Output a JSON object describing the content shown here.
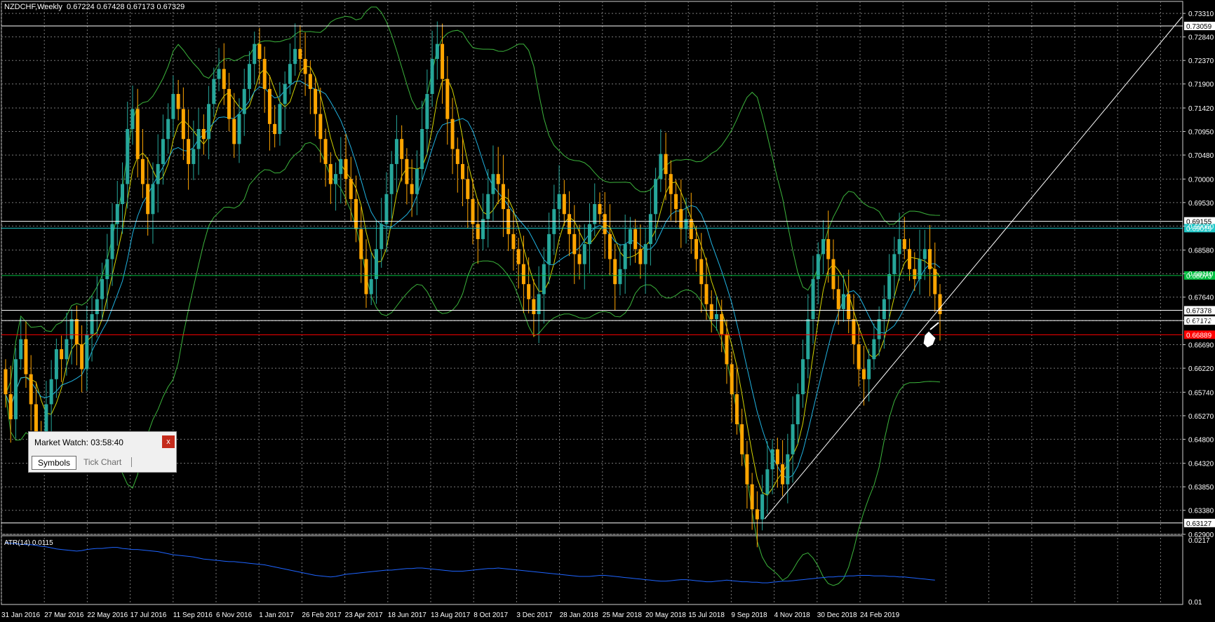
{
  "window": {
    "symbol_header": "NZDCHF,Weekly  0.67224 0.67428 0.67173 0.67329"
  },
  "colors": {
    "background": "#000000",
    "grid": "#7a7a7a",
    "bull_candle": "#26a69a",
    "bear_candle": "#ffa500",
    "bollinger": "#3cb43c",
    "ma_fast": "#d4d400",
    "ma_slow": "#20b2e0",
    "atr_line": "#1e64ff",
    "level_red": "#ff0000",
    "level_green": "#00c040",
    "level_cyan": "#20c8c8"
  },
  "price_axis": {
    "ticks": [
      "0.73310",
      "0.72840",
      "0.72370",
      "0.71900",
      "0.71420",
      "0.70950",
      "0.70480",
      "0.70000",
      "0.69530",
      "0.69060",
      "0.68580",
      "0.68110",
      "0.67640",
      "0.67170",
      "0.66690",
      "0.66220",
      "0.65740",
      "0.65270",
      "0.64800",
      "0.64320",
      "0.63850",
      "0.63380",
      "0.62900"
    ]
  },
  "price_levels": [
    {
      "price": 0.73059,
      "label": "0.73059",
      "style": "white"
    },
    {
      "price": 0.69155,
      "label": "0.69155",
      "style": "white"
    },
    {
      "price": 0.69019,
      "label": "0.69019",
      "style": "cyan"
    },
    {
      "price": 0.68073,
      "label": "0.68073",
      "style": "green"
    },
    {
      "price": 0.67378,
      "label": "0.67378",
      "style": "white"
    },
    {
      "price": 0.67172,
      "label": "0.67172",
      "style": "white"
    },
    {
      "price": 0.66889,
      "label": "0.66889",
      "style": "red"
    },
    {
      "price": 0.63127,
      "label": "0.63127",
      "style": "white"
    }
  ],
  "time_axis": {
    "labels": [
      "31 Jan 2016",
      "27 Mar 2016",
      "22 May 2016",
      "17 Jul 2016",
      "11 Sep 2016",
      "6 Nov 2016",
      "1 Jan 2017",
      "26 Feb 2017",
      "23 Apr 2017",
      "18 Jun 2017",
      "13 Aug 2017",
      "8 Oct 2017",
      "3 Dec 2017",
      "28 Jan 2018",
      "25 Mar 2018",
      "20 May 2018",
      "15 Jul 2018",
      "9 Sep 2018",
      "4 Nov 2018",
      "30 Dec 2018",
      "24 Feb 2019"
    ]
  },
  "atr_panel": {
    "label": "ATR(14) 0.0115",
    "ticks": [
      "0.0217",
      "0.01"
    ]
  },
  "market_watch": {
    "title": "Market Watch: 03:58:40",
    "close_label": "x",
    "tabs": [
      "Symbols",
      "Tick Chart"
    ]
  },
  "chart_data": {
    "type": "candlestick",
    "ylim": [
      0.629,
      0.7355
    ],
    "closes": [
      0.657,
      0.652,
      0.664,
      0.668,
      0.661,
      0.655,
      0.649,
      0.646,
      0.655,
      0.66,
      0.666,
      0.664,
      0.668,
      0.672,
      0.667,
      0.662,
      0.669,
      0.673,
      0.676,
      0.68,
      0.684,
      0.691,
      0.695,
      0.699,
      0.71,
      0.714,
      0.704,
      0.699,
      0.693,
      0.699,
      0.703,
      0.708,
      0.712,
      0.717,
      0.714,
      0.708,
      0.703,
      0.706,
      0.71,
      0.708,
      0.715,
      0.72,
      0.722,
      0.718,
      0.712,
      0.707,
      0.713,
      0.718,
      0.723,
      0.727,
      0.724,
      0.718,
      0.711,
      0.709,
      0.715,
      0.719,
      0.723,
      0.726,
      0.724,
      0.721,
      0.718,
      0.713,
      0.708,
      0.703,
      0.699,
      0.701,
      0.704,
      0.7,
      0.696,
      0.69,
      0.684,
      0.677,
      0.68,
      0.686,
      0.691,
      0.697,
      0.703,
      0.708,
      0.704,
      0.699,
      0.697,
      0.702,
      0.71,
      0.717,
      0.724,
      0.727,
      0.72,
      0.712,
      0.706,
      0.703,
      0.7,
      0.696,
      0.691,
      0.688,
      0.692,
      0.697,
      0.701,
      0.699,
      0.694,
      0.689,
      0.686,
      0.683,
      0.679,
      0.676,
      0.673,
      0.677,
      0.683,
      0.689,
      0.694,
      0.697,
      0.693,
      0.689,
      0.685,
      0.683,
      0.687,
      0.691,
      0.695,
      0.693,
      0.689,
      0.684,
      0.679,
      0.682,
      0.687,
      0.69,
      0.686,
      0.683,
      0.687,
      0.693,
      0.7,
      0.705,
      0.701,
      0.697,
      0.694,
      0.69,
      0.692,
      0.688,
      0.684,
      0.679,
      0.675,
      0.672,
      0.673,
      0.669,
      0.663,
      0.657,
      0.651,
      0.645,
      0.639,
      0.634,
      0.632,
      0.637,
      0.642,
      0.646,
      0.643,
      0.639,
      0.645,
      0.651,
      0.657,
      0.664,
      0.672,
      0.68,
      0.685,
      0.688,
      0.684,
      0.678,
      0.674,
      0.677,
      0.672,
      0.667,
      0.662,
      0.66,
      0.664,
      0.668,
      0.672,
      0.676,
      0.681,
      0.685,
      0.688,
      0.686,
      0.682,
      0.68,
      0.684,
      0.686,
      0.682,
      0.677,
      0.673
    ]
  },
  "atr_data": {
    "ylim": [
      0.0095,
      0.0225
    ],
    "values": [
      0.0212,
      0.0211,
      0.021,
      0.0209,
      0.0208,
      0.0208,
      0.0207,
      0.0205,
      0.0204,
      0.0202,
      0.02,
      0.0199,
      0.0198,
      0.0197,
      0.0196,
      0.0197,
      0.0199,
      0.02,
      0.0201,
      0.0201,
      0.0202,
      0.0203,
      0.0203,
      0.0201,
      0.02,
      0.0199,
      0.0199,
      0.0198,
      0.0197,
      0.0196,
      0.0195,
      0.0193,
      0.0191,
      0.0189,
      0.0188,
      0.0187,
      0.0186,
      0.0185,
      0.0183,
      0.0181,
      0.018,
      0.0179,
      0.0178,
      0.0177,
      0.0176,
      0.0176,
      0.0175,
      0.0174,
      0.0173,
      0.0172,
      0.0171,
      0.017,
      0.0168,
      0.0166,
      0.0164,
      0.0162,
      0.016,
      0.0158,
      0.0156,
      0.0154,
      0.0152,
      0.015,
      0.0149,
      0.0148,
      0.0147,
      0.0148,
      0.015,
      0.0152,
      0.0153,
      0.0154,
      0.0155,
      0.0156,
      0.0157,
      0.0158,
      0.0159,
      0.016,
      0.016,
      0.0161,
      0.0162,
      0.0163,
      0.0163,
      0.0164,
      0.0164,
      0.0163,
      0.0162,
      0.0161,
      0.016,
      0.0159,
      0.0158,
      0.0158,
      0.0158,
      0.0159,
      0.016,
      0.0161,
      0.0162,
      0.0163,
      0.0163,
      0.0164,
      0.0163,
      0.0162,
      0.0161,
      0.016,
      0.0159,
      0.0158,
      0.0157,
      0.0156,
      0.0155,
      0.0154,
      0.0153,
      0.0152,
      0.0151,
      0.015,
      0.0149,
      0.0148,
      0.0148,
      0.0148,
      0.0149,
      0.015,
      0.015,
      0.0149,
      0.0148,
      0.0147,
      0.0146,
      0.0145,
      0.0144,
      0.0143,
      0.0142,
      0.0141,
      0.014,
      0.0139,
      0.0139,
      0.014,
      0.0141,
      0.0142,
      0.0142,
      0.0141,
      0.014,
      0.0139,
      0.0138,
      0.0138,
      0.0139,
      0.014,
      0.0141,
      0.014,
      0.0139,
      0.0138,
      0.0138,
      0.0137,
      0.0137,
      0.0136,
      0.0136,
      0.0137,
      0.0138,
      0.0139,
      0.0139,
      0.014,
      0.0141,
      0.0142,
      0.0143,
      0.0144,
      0.0145,
      0.0146,
      0.0147,
      0.0147,
      0.0148,
      0.0148,
      0.0149,
      0.0149,
      0.015,
      0.015,
      0.015,
      0.0149,
      0.0149,
      0.0149,
      0.0148,
      0.0148,
      0.0147,
      0.0147,
      0.0146,
      0.0145,
      0.0144,
      0.0143,
      0.0142,
      0.0141
    ]
  }
}
